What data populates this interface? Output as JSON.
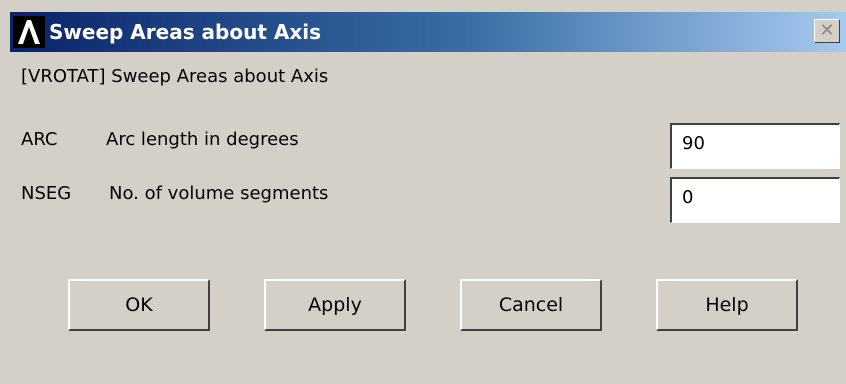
{
  "window": {
    "title": "Sweep Areas about Axis",
    "close_glyph": "✕",
    "logo_icon": "ansys-logo-icon"
  },
  "header": {
    "subtitle": "[VROTAT]  Sweep Areas about Axis"
  },
  "params": [
    {
      "name": "ARC",
      "description": "Arc length in degrees",
      "value": "90"
    },
    {
      "name": "NSEG",
      "description": "No. of volume segments",
      "value": "0"
    }
  ],
  "buttons": {
    "ok": "OK",
    "apply": "Apply",
    "cancel": "Cancel",
    "help": "Help"
  },
  "colors": {
    "title_gradient_start": "#0a246a",
    "title_gradient_end": "#a6caf0",
    "dialog_background": "#d4d0c8"
  }
}
